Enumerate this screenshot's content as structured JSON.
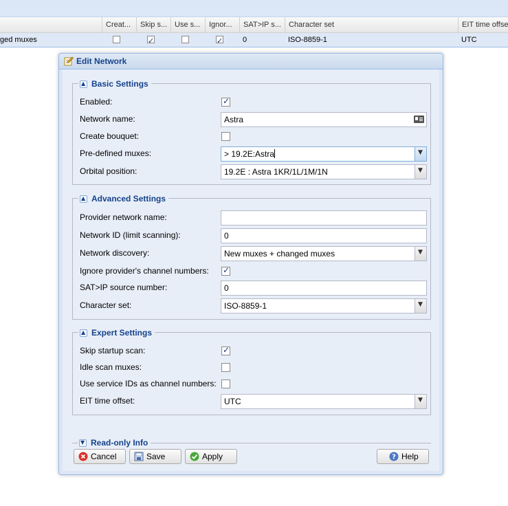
{
  "grid": {
    "columns": [
      "Creat...",
      "Skip s...",
      "Use s...",
      "Ignor...",
      "SAT>IP s...",
      "Character set",
      "EIT time offset"
    ],
    "row": {
      "name": "ged muxes",
      "create_bouquet": false,
      "skip_startup": true,
      "use_service_ids": false,
      "ignore_channel_numbers": true,
      "satip_source": "0",
      "charset": "ISO-8859-1",
      "eit_offset": "UTC"
    }
  },
  "window": {
    "title": "Edit Network",
    "basic": {
      "legend": "Basic Settings",
      "enabled_label": "Enabled:",
      "enabled": true,
      "network_name_label": "Network name:",
      "network_name": "Astra",
      "create_bouquet_label": "Create bouquet:",
      "create_bouquet": false,
      "predefined_label": "Pre-defined muxes:",
      "predefined_value": "> 19.2E:Astra",
      "orbital_label": "Orbital position:",
      "orbital_value": "19.2E : Astra 1KR/1L/1M/1N"
    },
    "advanced": {
      "legend": "Advanced Settings",
      "provider_label": "Provider network name:",
      "provider_value": "",
      "network_id_label": "Network ID (limit scanning):",
      "network_id": "0",
      "discovery_label": "Network discovery:",
      "discovery_value": "New muxes + changed muxes",
      "ignore_label": "Ignore provider's channel numbers:",
      "ignore": true,
      "satip_label": "SAT>IP source number:",
      "satip_value": "0",
      "charset_label": "Character set:",
      "charset_value": "ISO-8859-1"
    },
    "expert": {
      "legend": "Expert Settings",
      "skip_label": "Skip startup scan:",
      "skip": true,
      "idle_label": "Idle scan muxes:",
      "idle": false,
      "use_sid_label": "Use service IDs as channel numbers:",
      "use_sid": false,
      "eit_label": "EIT time offset:",
      "eit_value": "UTC"
    },
    "readonly": {
      "legend": "Read-only Info"
    },
    "buttons": {
      "cancel": "Cancel",
      "save": "Save",
      "apply": "Apply",
      "help": "Help"
    }
  },
  "colors": {
    "accent": "#15428b",
    "selection": "#dfe8f6",
    "border": "#99bbe8"
  },
  "icons": [
    "edit-network-icon",
    "collapse-icon",
    "expand-icon",
    "card-icon",
    "dropdown-arrow-icon",
    "cancel-icon",
    "save-icon",
    "apply-icon",
    "help-icon"
  ]
}
